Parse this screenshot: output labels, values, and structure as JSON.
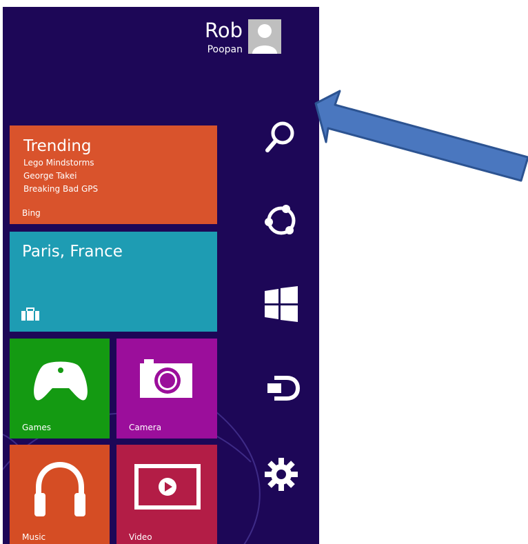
{
  "user": {
    "first_name": "Rob",
    "last_name": "Poopan"
  },
  "tiles": {
    "trending": {
      "title": "Trending",
      "items": [
        "Lego Mindstorms",
        "George Takei",
        "Breaking Bad GPS"
      ],
      "label": "Bing",
      "color": "#d9532c"
    },
    "travel": {
      "title": "Paris, France",
      "icon": "suitcase-icon",
      "color": "#1e9cb3"
    },
    "games": {
      "label": "Games",
      "icon": "game-controller-icon",
      "color": "#149a12"
    },
    "camera": {
      "label": "Camera",
      "icon": "camera-icon",
      "color": "#9b0e9b"
    },
    "music": {
      "label": "Music",
      "icon": "headphones-icon",
      "color": "#d54d24"
    },
    "video": {
      "label": "Video",
      "icon": "play-icon",
      "color": "#b31d46"
    }
  },
  "charms": [
    {
      "name": "search",
      "icon": "search-icon"
    },
    {
      "name": "share",
      "icon": "share-icon"
    },
    {
      "name": "start",
      "icon": "windows-logo-icon"
    },
    {
      "name": "devices",
      "icon": "devices-icon"
    },
    {
      "name": "settings",
      "icon": "gear-icon"
    }
  ],
  "colors": {
    "background": "#1d0757",
    "annotation_arrow": "#4a77bf"
  }
}
